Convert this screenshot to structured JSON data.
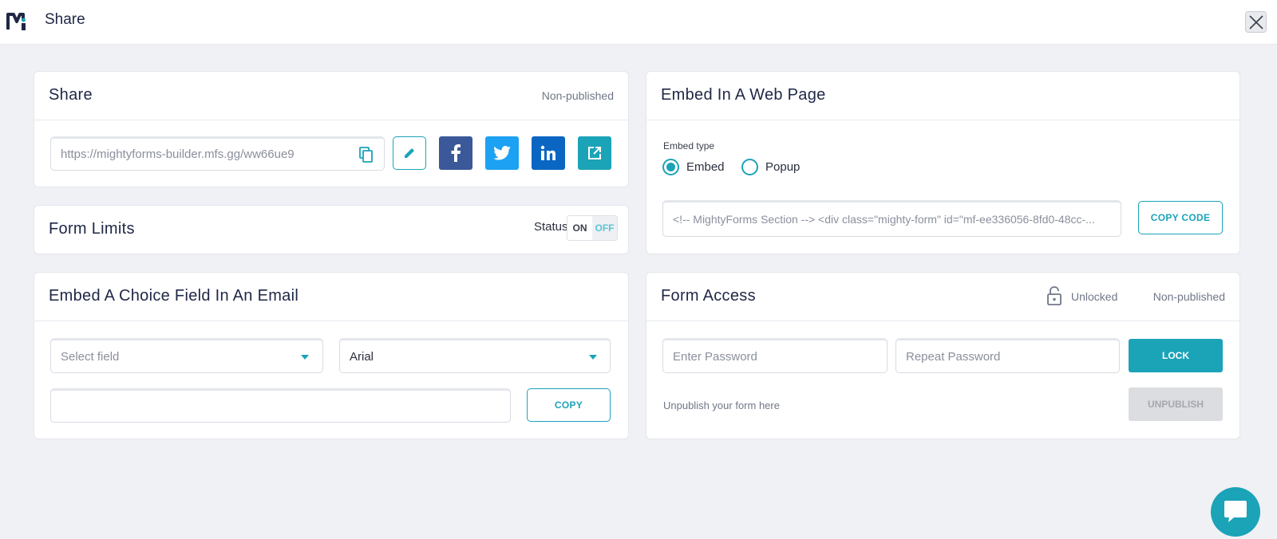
{
  "header": {
    "title": "Share"
  },
  "share_card": {
    "title": "Share",
    "status": "Non-published",
    "url": "https://mightyforms-builder.mfs.gg/ww66ue9",
    "social": [
      {
        "name": "facebook",
        "icon": "facebook-icon",
        "color": "#3b5998"
      },
      {
        "name": "twitter",
        "icon": "twitter-icon",
        "color": "#1da1f2"
      },
      {
        "name": "linkedin",
        "icon": "linkedin-icon",
        "color": "#0a66c2"
      },
      {
        "name": "open-link",
        "icon": "external-link-icon",
        "color": "#1ba3b8"
      }
    ]
  },
  "form_limits": {
    "title": "Form Limits",
    "status_label": "Status",
    "on_label": "ON",
    "off_label": "OFF",
    "active": "OFF"
  },
  "embed_email": {
    "title": "Embed A Choice Field In An Email",
    "select_field_placeholder": "Select field",
    "font_value": "Arial",
    "code_value": "",
    "copy_label": "COPY"
  },
  "embed_web": {
    "title": "Embed In A Web Page",
    "embed_type_label": "Embed type",
    "options": [
      "Embed",
      "Popup"
    ],
    "selected": "Embed",
    "code_snippet": "<!-- MightyForms Section --> <div class=\"mighty-form\" id=\"mf-ee336056-8fd0-48cc-...",
    "copy_code_label": "COPY CODE"
  },
  "form_access": {
    "title": "Form Access",
    "lock_status": "Unlocked",
    "publish_status": "Non-published",
    "password_placeholder": "Enter Password",
    "repeat_placeholder": "Repeat Password",
    "lock_label": "LOCK",
    "unpublish_text": "Unpublish your form here",
    "unpublish_label": "UNPUBLISH"
  },
  "colors": {
    "accent": "#1ba3b8",
    "navy": "#1f2746",
    "background": "#f0f1f5"
  }
}
